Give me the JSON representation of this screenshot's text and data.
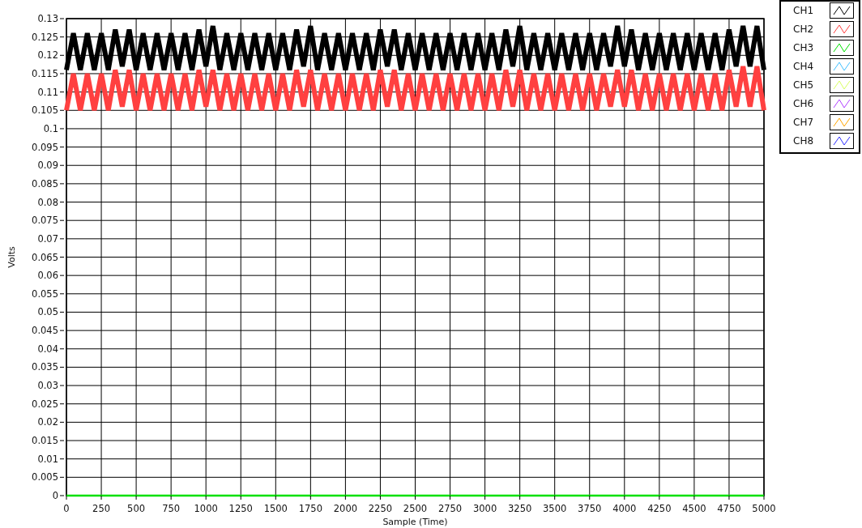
{
  "graph": {
    "chart_data": {
      "type": "line",
      "xlabel": "Sample (Time)",
      "ylabel": "Volts",
      "xlim": [
        0,
        5000
      ],
      "ylim": [
        0,
        0.13
      ],
      "xticks": [
        0,
        250,
        500,
        750,
        1000,
        1250,
        1500,
        1750,
        2000,
        2250,
        2500,
        2750,
        3000,
        3250,
        3500,
        3750,
        4000,
        4250,
        4500,
        4750,
        5000
      ],
      "yticks": [
        0,
        0.005,
        0.01,
        0.015,
        0.02,
        0.025,
        0.03,
        0.035,
        0.04,
        0.045,
        0.05,
        0.055,
        0.06,
        0.065,
        0.07,
        0.075,
        0.08,
        0.085,
        0.09,
        0.095,
        0.1,
        0.105,
        0.11,
        0.115,
        0.12,
        0.125,
        0.13
      ],
      "x": [
        0,
        50,
        100,
        150,
        200,
        250,
        300,
        350,
        400,
        450,
        500,
        550,
        600,
        650,
        700,
        750,
        800,
        850,
        900,
        950,
        1000,
        1050,
        1100,
        1150,
        1200,
        1250,
        1300,
        1350,
        1400,
        1450,
        1500,
        1550,
        1600,
        1650,
        1700,
        1750,
        1800,
        1850,
        1900,
        1950,
        2000,
        2050,
        2100,
        2150,
        2200,
        2250,
        2300,
        2350,
        2400,
        2450,
        2500,
        2550,
        2600,
        2650,
        2700,
        2750,
        2800,
        2850,
        2900,
        2950,
        3000,
        3050,
        3100,
        3150,
        3200,
        3250,
        3300,
        3350,
        3400,
        3450,
        3500,
        3550,
        3600,
        3650,
        3700,
        3750,
        3800,
        3850,
        3900,
        3950,
        4000,
        4050,
        4100,
        4150,
        4200,
        4250,
        4300,
        4350,
        4400,
        4450,
        4500,
        4550,
        4600,
        4650,
        4700,
        4750,
        4800,
        4850,
        4900,
        4950,
        5000
      ],
      "series": [
        {
          "name": "CH1",
          "color": "#000000",
          "values": [
            0.116,
            0.126,
            0.116,
            0.126,
            0.116,
            0.126,
            0.116,
            0.127,
            0.117,
            0.127,
            0.116,
            0.126,
            0.116,
            0.126,
            0.116,
            0.126,
            0.116,
            0.126,
            0.116,
            0.127,
            0.117,
            0.128,
            0.116,
            0.126,
            0.116,
            0.126,
            0.116,
            0.126,
            0.116,
            0.126,
            0.116,
            0.126,
            0.116,
            0.127,
            0.117,
            0.128,
            0.116,
            0.126,
            0.116,
            0.126,
            0.116,
            0.126,
            0.116,
            0.126,
            0.116,
            0.127,
            0.117,
            0.127,
            0.116,
            0.126,
            0.116,
            0.126,
            0.116,
            0.126,
            0.116,
            0.126,
            0.116,
            0.126,
            0.116,
            0.126,
            0.116,
            0.126,
            0.116,
            0.127,
            0.117,
            0.128,
            0.116,
            0.126,
            0.116,
            0.126,
            0.116,
            0.126,
            0.116,
            0.126,
            0.116,
            0.126,
            0.116,
            0.126,
            0.117,
            0.128,
            0.117,
            0.127,
            0.116,
            0.126,
            0.116,
            0.126,
            0.116,
            0.126,
            0.116,
            0.126,
            0.116,
            0.126,
            0.116,
            0.126,
            0.116,
            0.127,
            0.117,
            0.128,
            0.117,
            0.128,
            0.116
          ]
        },
        {
          "name": "CH2",
          "color": "#ff4040",
          "values": [
            0.105,
            0.115,
            0.105,
            0.115,
            0.105,
            0.115,
            0.105,
            0.116,
            0.106,
            0.116,
            0.105,
            0.115,
            0.105,
            0.115,
            0.105,
            0.115,
            0.105,
            0.115,
            0.105,
            0.116,
            0.106,
            0.116,
            0.105,
            0.115,
            0.105,
            0.115,
            0.105,
            0.115,
            0.105,
            0.115,
            0.105,
            0.115,
            0.105,
            0.116,
            0.106,
            0.116,
            0.105,
            0.115,
            0.105,
            0.115,
            0.105,
            0.115,
            0.105,
            0.115,
            0.105,
            0.116,
            0.106,
            0.116,
            0.105,
            0.115,
            0.105,
            0.115,
            0.105,
            0.115,
            0.105,
            0.115,
            0.105,
            0.115,
            0.105,
            0.115,
            0.105,
            0.115,
            0.105,
            0.116,
            0.106,
            0.116,
            0.105,
            0.115,
            0.105,
            0.115,
            0.105,
            0.115,
            0.105,
            0.115,
            0.105,
            0.115,
            0.105,
            0.115,
            0.106,
            0.116,
            0.106,
            0.116,
            0.105,
            0.115,
            0.105,
            0.115,
            0.105,
            0.115,
            0.105,
            0.115,
            0.105,
            0.115,
            0.105,
            0.115,
            0.105,
            0.116,
            0.106,
            0.117,
            0.106,
            0.117,
            0.105
          ]
        },
        {
          "name": "CH3",
          "color": "#00e000",
          "values": [
            0,
            0,
            0,
            0,
            0,
            0,
            0,
            0,
            0,
            0,
            0,
            0,
            0,
            0,
            0,
            0,
            0,
            0,
            0,
            0,
            0,
            0,
            0,
            0,
            0,
            0,
            0,
            0,
            0,
            0,
            0,
            0,
            0,
            0,
            0,
            0,
            0,
            0,
            0,
            0,
            0,
            0,
            0,
            0,
            0,
            0,
            0,
            0,
            0,
            0,
            0,
            0,
            0,
            0,
            0,
            0,
            0,
            0,
            0,
            0,
            0,
            0,
            0,
            0,
            0,
            0,
            0,
            0,
            0,
            0,
            0,
            0,
            0,
            0,
            0,
            0,
            0,
            0,
            0,
            0,
            0,
            0,
            0,
            0,
            0,
            0,
            0,
            0,
            0,
            0,
            0,
            0,
            0,
            0,
            0,
            0,
            0,
            0,
            0,
            0,
            0
          ]
        },
        {
          "name": "CH4",
          "color": "#40c0ff",
          "values": [
            null,
            null,
            null,
            null,
            null,
            null,
            null,
            null,
            null,
            null,
            null,
            null,
            null,
            null,
            null,
            null,
            null,
            null,
            null,
            null,
            null,
            null,
            null,
            null,
            null,
            null,
            null,
            null,
            null,
            null,
            null,
            null,
            null,
            null,
            null,
            null,
            null,
            null,
            null,
            null,
            null,
            null,
            null,
            null,
            null,
            null,
            null,
            null,
            null,
            null,
            null,
            null,
            null,
            null,
            null,
            null,
            null,
            null,
            null,
            null,
            null,
            null,
            null,
            null,
            null,
            null,
            null,
            null,
            null,
            null,
            null,
            null,
            null,
            null,
            null,
            null,
            null,
            null,
            null,
            null,
            null,
            null,
            null,
            null,
            null,
            null,
            null,
            null,
            null,
            null,
            null,
            null,
            null,
            null,
            null,
            null,
            null,
            null,
            null,
            null,
            null
          ]
        },
        {
          "name": "CH5",
          "color": "#d8ff60",
          "values": [
            null,
            null,
            null,
            null,
            null,
            null,
            null,
            null,
            null,
            null,
            null,
            null,
            null,
            null,
            null,
            null,
            null,
            null,
            null,
            null,
            null,
            null,
            null,
            null,
            null,
            null,
            null,
            null,
            null,
            null,
            null,
            null,
            null,
            null,
            null,
            null,
            null,
            null,
            null,
            null,
            null,
            null,
            null,
            null,
            null,
            null,
            null,
            null,
            null,
            null,
            null,
            null,
            null,
            null,
            null,
            null,
            null,
            null,
            null,
            null,
            null,
            null,
            null,
            null,
            null,
            null,
            null,
            null,
            null,
            null,
            null,
            null,
            null,
            null,
            null,
            null,
            null,
            null,
            null,
            null,
            null,
            null,
            null,
            null,
            null,
            null,
            null,
            null,
            null,
            null,
            null,
            null,
            null,
            null,
            null,
            null,
            null,
            null,
            null,
            null,
            null
          ]
        },
        {
          "name": "CH6",
          "color": "#b040ff",
          "values": [
            null,
            null,
            null,
            null,
            null,
            null,
            null,
            null,
            null,
            null,
            null,
            null,
            null,
            null,
            null,
            null,
            null,
            null,
            null,
            null,
            null,
            null,
            null,
            null,
            null,
            null,
            null,
            null,
            null,
            null,
            null,
            null,
            null,
            null,
            null,
            null,
            null,
            null,
            null,
            null,
            null,
            null,
            null,
            null,
            null,
            null,
            null,
            null,
            null,
            null,
            null,
            null,
            null,
            null,
            null,
            null,
            null,
            null,
            null,
            null,
            null,
            null,
            null,
            null,
            null,
            null,
            null,
            null,
            null,
            null,
            null,
            null,
            null,
            null,
            null,
            null,
            null,
            null,
            null,
            null,
            null,
            null,
            null,
            null,
            null,
            null,
            null,
            null,
            null,
            null,
            null,
            null,
            null,
            null,
            null,
            null,
            null,
            null,
            null,
            null,
            null
          ]
        },
        {
          "name": "CH7",
          "color": "#ffa500",
          "values": [
            null,
            null,
            null,
            null,
            null,
            null,
            null,
            null,
            null,
            null,
            null,
            null,
            null,
            null,
            null,
            null,
            null,
            null,
            null,
            null,
            null,
            null,
            null,
            null,
            null,
            null,
            null,
            null,
            null,
            null,
            null,
            null,
            null,
            null,
            null,
            null,
            null,
            null,
            null,
            null,
            null,
            null,
            null,
            null,
            null,
            null,
            null,
            null,
            null,
            null,
            null,
            null,
            null,
            null,
            null,
            null,
            null,
            null,
            null,
            null,
            null,
            null,
            null,
            null,
            null,
            null,
            null,
            null,
            null,
            null,
            null,
            null,
            null,
            null,
            null,
            null,
            null,
            null,
            null,
            null,
            null,
            null,
            null,
            null,
            null,
            null,
            null,
            null,
            null,
            null,
            null,
            null,
            null,
            null,
            null,
            null,
            null,
            null,
            null,
            null,
            null
          ]
        },
        {
          "name": "CH8",
          "color": "#3030ff",
          "values": [
            null,
            null,
            null,
            null,
            null,
            null,
            null,
            null,
            null,
            null,
            null,
            null,
            null,
            null,
            null,
            null,
            null,
            null,
            null,
            null,
            null,
            null,
            null,
            null,
            null,
            null,
            null,
            null,
            null,
            null,
            null,
            null,
            null,
            null,
            null,
            null,
            null,
            null,
            null,
            null,
            null,
            null,
            null,
            null,
            null,
            null,
            null,
            null,
            null,
            null,
            null,
            null,
            null,
            null,
            null,
            null,
            null,
            null,
            null,
            null,
            null,
            null,
            null,
            null,
            null,
            null,
            null,
            null,
            null,
            null,
            null,
            null,
            null,
            null,
            null,
            null,
            null,
            null,
            null,
            null,
            null,
            null,
            null,
            null,
            null,
            null,
            null,
            null,
            null,
            null,
            null,
            null,
            null,
            null,
            null,
            null,
            null,
            null,
            null,
            null,
            null
          ]
        }
      ]
    }
  }
}
